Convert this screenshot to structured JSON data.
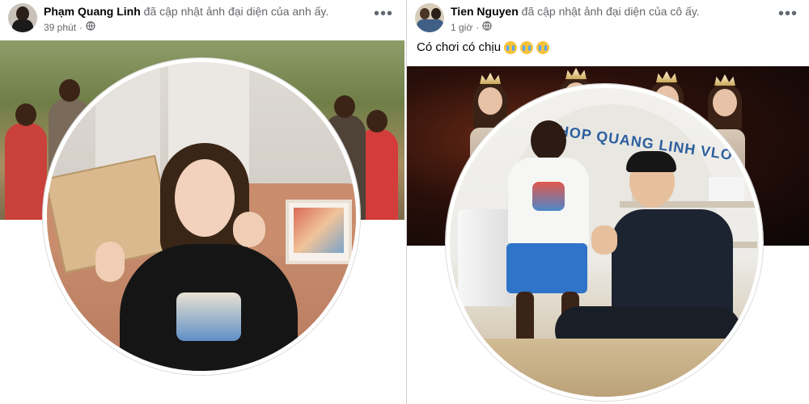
{
  "left_post": {
    "author": "Phạm Quang Linh",
    "action": "đã cập nhật ảnh đại diện của anh ấy.",
    "time": "39 phút",
    "privacy_icon": "globe-icon",
    "more_icon": "more-options-icon"
  },
  "right_post": {
    "author": "Tien Nguyen",
    "action": "đã cập nhật ảnh đại diện của cô ấy.",
    "time": "1 giờ",
    "privacy_icon": "globe-icon",
    "more_icon": "more-options-icon",
    "caption": "Có chơi có chịu",
    "caption_emojis": [
      "crying-face",
      "crying-face",
      "crying-face"
    ],
    "shop_sign": "SHOP QUANG LINH VLOG"
  },
  "colors": {
    "name_text": "#050505",
    "meta_text": "#65676b",
    "sign_text": "#2c5f9e"
  }
}
